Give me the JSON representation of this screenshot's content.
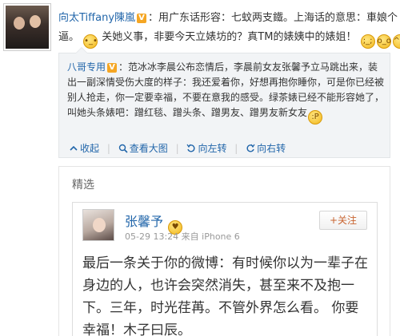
{
  "post": {
    "username": "向太Tiffany陳嵐",
    "line1": "：用广东话形容：七蚊两支鐵。上海话的意思：車娘个",
    "line2_a": "逼。",
    "line2_b": "关她义事，非要今天立婊坊的？真TM的婊姨中的婊姐！",
    "emoji_a": "sleepy-face",
    "emoji_b": [
      "crying-face",
      "scared-face",
      "grinning-face"
    ]
  },
  "repost": {
    "username": "八哥专用",
    "text": "：范冰冰李晨公布恋情后，李晨前女友张馨予立马跳出来，装出一副深情受伤大度的样子：我还爱着你，好想再抱你睡你，可是你已经被别人抢走，你一定要幸福，不要在意我的感受。绿茶婊已经不能形容她了，叫她头条婊吧：蹭红毯、蹭头条、蹭男友、蹭男友新女友",
    "emoji": "tongue-face",
    "actions": {
      "collapse": "收起",
      "view_image": "查看大图",
      "rotate_left": "向左转",
      "rotate_right": "向右转"
    }
  },
  "featured": {
    "title": "精选",
    "card": {
      "name": "张馨予",
      "date": "05-29 13:24",
      "source": "来自 iPhone 6",
      "follow_label": "+关注",
      "text": "最后一条关于你的微博：有时候你以为一辈子在身边的人，也许会突然消失，甚至来不及抱一下。三年，时光荏苒。不管外界怎么看。 你要幸福！木子曰辰。"
    }
  }
}
